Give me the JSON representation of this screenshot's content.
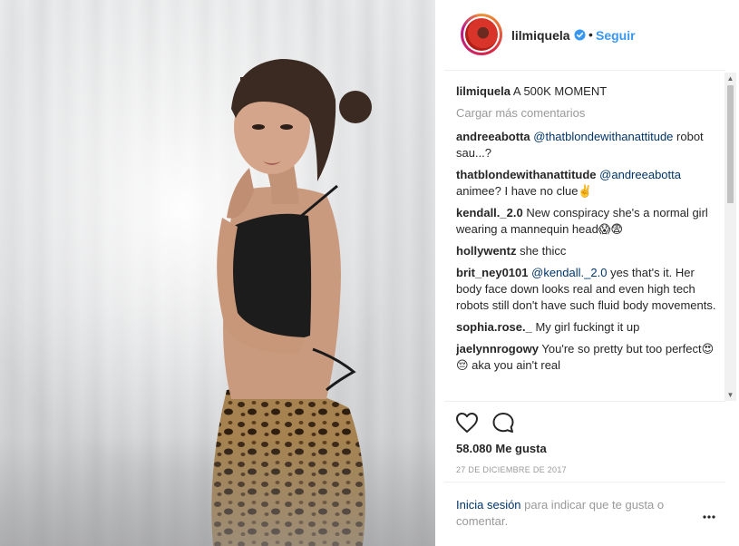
{
  "post": {
    "username": "lilmiquela",
    "follow_label": "Seguir",
    "separator": "•",
    "caption_user": "lilmiquela",
    "caption_text": "A 500K MOMENT",
    "load_more": "Cargar más comentarios",
    "comments": [
      {
        "user": "andreeabotta",
        "mention": "@thatblondewithanattitude",
        "text": "robot sau...?"
      },
      {
        "user": "thatblondewithanattitude",
        "mention": "@andreeabotta",
        "text": "animee? I have no clue✌️"
      },
      {
        "user": "kendall._2.0",
        "mention": "",
        "text": "New conspiracy she's a normal girl wearing a mannequin head😱😨"
      },
      {
        "user": "hollywentz",
        "mention": "",
        "text": "she thicc"
      },
      {
        "user": "brit_ney0101",
        "mention": "@kendall._2.0",
        "text": "yes that's it. Her body face down looks real and even high tech robots still don't have such fluid body movements."
      },
      {
        "user": "sophia.rose._",
        "mention": "",
        "text": "My girl fuckingt it up"
      },
      {
        "user": "jaelynnrogowy",
        "mention": "",
        "text": "You're so pretty but too perfect😍😔 aka you ain't real"
      }
    ],
    "likes": "58.080 Me gusta",
    "date": "27 DE DICIEMBRE DE 2017",
    "login_link": "Inicia sesión",
    "login_rest": "para indicar que te gusta o comentar."
  },
  "icons": {
    "verified": "verified-badge-icon",
    "like": "heart-icon",
    "comment": "comment-icon",
    "more": "more-options-icon"
  },
  "colors": {
    "link": "#3897f0",
    "mention": "#003569",
    "muted": "#999999",
    "text": "#262626"
  }
}
